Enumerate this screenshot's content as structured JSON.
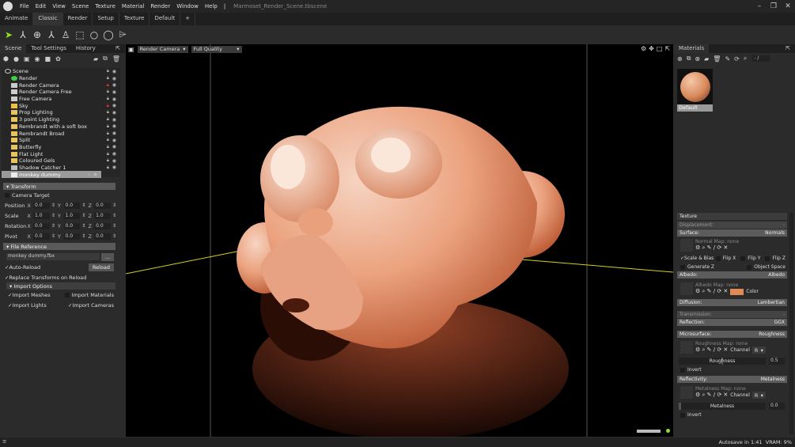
{
  "menu": {
    "items": [
      "File",
      "Edit",
      "View",
      "Scene",
      "Texture",
      "Material",
      "Render",
      "Window",
      "Help"
    ],
    "title": "Marmoset_Render_Scene.tbscene"
  },
  "tabs": [
    "Animate",
    "Classic",
    "Render",
    "Setup",
    "Texture",
    "Default",
    "+"
  ],
  "left": {
    "tabs": [
      "Scene",
      "Tool Settings",
      "History"
    ],
    "tree": [
      {
        "label": "Scene",
        "icon": "scene-icon",
        "locked": false
      },
      {
        "label": "Render",
        "icon": "render-icon",
        "locked": false
      },
      {
        "label": "Render Camera",
        "icon": "camera-icon",
        "locked": true
      },
      {
        "label": "Render Camera Free",
        "icon": "camera-icon",
        "locked": false
      },
      {
        "label": "Free Camera",
        "icon": "camera-icon",
        "locked": false
      },
      {
        "label": "Sky",
        "icon": "sky-icon",
        "locked": true
      },
      {
        "label": "Prop Lighting",
        "icon": "folder-icon",
        "locked": false
      },
      {
        "label": "3 point Lighting",
        "icon": "folder-icon",
        "locked": false
      },
      {
        "label": "Rembrandt with a soft box",
        "icon": "folder-icon",
        "locked": false
      },
      {
        "label": "Rembrandt Broad",
        "icon": "folder-icon",
        "locked": false
      },
      {
        "label": "Split",
        "icon": "folder-icon",
        "locked": false
      },
      {
        "label": "Butterfly",
        "icon": "folder-icon",
        "locked": false
      },
      {
        "label": "Flat Light",
        "icon": "folder-icon",
        "locked": false
      },
      {
        "label": "Coloured Gels",
        "icon": "folder-icon",
        "locked": false
      },
      {
        "label": "Shadow Catcher 1",
        "icon": "shadow-icon",
        "locked": false
      },
      {
        "label": "monkey dummy",
        "icon": "mesh-icon",
        "locked": false
      }
    ],
    "transform": {
      "title": "Transform",
      "camera_target": "Camera Target",
      "rows": [
        {
          "label": "Position",
          "x": "0.0",
          "y": "0.0",
          "z": "0.0"
        },
        {
          "label": "Scale",
          "x": "1.0",
          "y": "1.0",
          "z": "1.0"
        },
        {
          "label": "Rotation",
          "x": "0.0",
          "y": "0.0",
          "z": "0.0"
        },
        {
          "label": "Pivot",
          "x": "0.0",
          "y": "0.0",
          "z": "0.0"
        }
      ],
      "axes": [
        "X",
        "Y",
        "Z"
      ]
    },
    "file_ref": {
      "title": "File Reference",
      "file": "monkey dummy.fbx",
      "browse": "...",
      "auto_reload": "Auto-Reload",
      "reload": "Reload",
      "replace": "Replace Transforms on Reload",
      "import_title": "Import Options",
      "import_meshes": "Import Meshes",
      "import_materials": "Import Materials",
      "import_lights": "Import Lights",
      "import_cameras": "Import Cameras"
    }
  },
  "viewport": {
    "camera": "Render Camera",
    "quality": "Full Quality"
  },
  "right": {
    "tab": "Materials",
    "counter": "- /",
    "material": "Default",
    "texture": "Texture",
    "displacement": {
      "label": "Displacement:",
      "value": "-"
    },
    "surface": {
      "label": "Surface:",
      "value": "Normals",
      "map": "Normal Map: none",
      "scale_bias": "Scale & Bias",
      "flipx": "Flip X",
      "flipy": "Flip Y",
      "flipz": "Flip Z",
      "genz": "Generate Z",
      "objspace": "Object Space"
    },
    "albedo": {
      "label": "Albedo:",
      "value": "Albedo",
      "map": "Albedo Map: none",
      "color_label": "Color",
      "color": "#e08a55"
    },
    "diffusion": {
      "label": "Diffusion:",
      "value": "Lambertian"
    },
    "transmission": {
      "label": "Transmission:",
      "value": "-"
    },
    "reflection": {
      "label": "Reflection:",
      "value": "GGX"
    },
    "microsurface": {
      "label": "Microsurface:",
      "value": "Roughness",
      "map": "Roughness Map: none",
      "channel": "Channel",
      "channel_value": "R",
      "slider_label": "Roughness",
      "slider_value": "0.5",
      "slider_fraction": 0.5,
      "invert": "Invert"
    },
    "reflectivity": {
      "label": "Reflectivity:",
      "value": "Metalness",
      "map": "Metalness Map: none",
      "channel": "Channel",
      "channel_value": "R",
      "slider_label": "Metalness",
      "slider_value": "0.0",
      "slider_fraction": 0.0,
      "invert": "Invert"
    }
  },
  "status": {
    "text": "Autosave in 1:41  VRAM: 9%"
  }
}
